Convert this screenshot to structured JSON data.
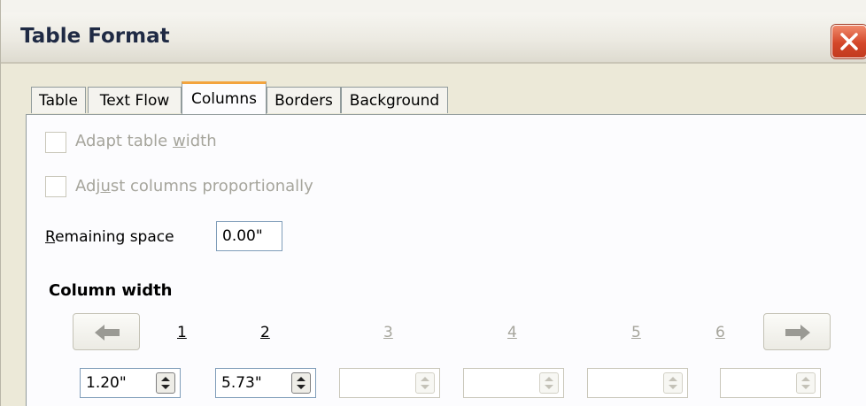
{
  "window": {
    "title": "Table Format"
  },
  "tabs": [
    {
      "label": "Table",
      "active": false
    },
    {
      "label": "Text Flow",
      "active": false
    },
    {
      "label": "Columns",
      "active": true
    },
    {
      "label": "Borders",
      "active": false
    },
    {
      "label": "Background",
      "active": false
    }
  ],
  "columns": {
    "adapt_table_width": {
      "label_pre": "Adapt table ",
      "label_u": "w",
      "label_post": "idth",
      "checked": false,
      "enabled": false
    },
    "adjust_proportionally": {
      "label_pre": "Adj",
      "label_u": "u",
      "label_post": "st columns proportionally",
      "checked": false,
      "enabled": false
    },
    "remaining_space": {
      "label_u": "R",
      "label_post": "emaining space",
      "value": "0.00\""
    },
    "column_width": {
      "heading": "Column width",
      "column_numbers": [
        "1",
        "2",
        "3",
        "4",
        "5",
        "6"
      ],
      "values": [
        "1.20\"",
        "5.73\"",
        "",
        "",
        "",
        ""
      ],
      "enabled": [
        true,
        true,
        false,
        false,
        false,
        false
      ]
    }
  },
  "colors": {
    "disabled_text": "#a6a59c",
    "active_tab_accent": "#f3a43e",
    "close_button": "#d4472a"
  }
}
